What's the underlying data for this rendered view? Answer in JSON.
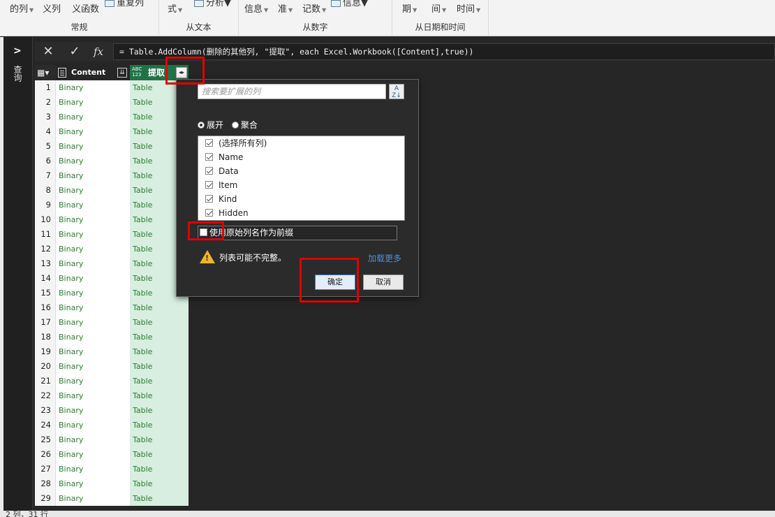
{
  "ribbon": {
    "groups": [
      {
        "label": "常规"
      },
      {
        "label": "从文本"
      },
      {
        "label": "从数字"
      },
      {
        "label": "从日期和时间"
      }
    ],
    "items": {
      "col_a": "的列",
      "col_b": "义列",
      "col_c": "义函数",
      "col_d": "重复列",
      "fmt": "式",
      "analyze": "分析",
      "info": "信息",
      "std": "准",
      "notation": "记数",
      "info2": "信息",
      "period": "期",
      "between": "间",
      "time": "时间"
    }
  },
  "rail": {
    "label": "查询"
  },
  "formula_bar": {
    "text": "= Table.AddColumn(删除的其他列, \"提取\", each Excel.Workbook([Content],true))"
  },
  "table": {
    "col1_header": "Content",
    "col2_header": "提取",
    "type_badge_top": "ABC",
    "type_badge_bottom": "123",
    "rows": [
      {
        "n": "1",
        "c1": "Binary",
        "c2": "Table"
      },
      {
        "n": "2",
        "c1": "Binary",
        "c2": "Table"
      },
      {
        "n": "3",
        "c1": "Binary",
        "c2": "Table"
      },
      {
        "n": "4",
        "c1": "Binary",
        "c2": "Table"
      },
      {
        "n": "5",
        "c1": "Binary",
        "c2": "Table"
      },
      {
        "n": "6",
        "c1": "Binary",
        "c2": "Table"
      },
      {
        "n": "7",
        "c1": "Binary",
        "c2": "Table"
      },
      {
        "n": "8",
        "c1": "Binary",
        "c2": "Table"
      },
      {
        "n": "9",
        "c1": "Binary",
        "c2": "Table"
      },
      {
        "n": "10",
        "c1": "Binary",
        "c2": "Table"
      },
      {
        "n": "11",
        "c1": "Binary",
        "c2": "Table"
      },
      {
        "n": "12",
        "c1": "Binary",
        "c2": "Table"
      },
      {
        "n": "13",
        "c1": "Binary",
        "c2": "Table"
      },
      {
        "n": "14",
        "c1": "Binary",
        "c2": "Table"
      },
      {
        "n": "15",
        "c1": "Binary",
        "c2": "Table"
      },
      {
        "n": "16",
        "c1": "Binary",
        "c2": "Table"
      },
      {
        "n": "17",
        "c1": "Binary",
        "c2": "Table"
      },
      {
        "n": "18",
        "c1": "Binary",
        "c2": "Table"
      },
      {
        "n": "19",
        "c1": "Binary",
        "c2": "Table"
      },
      {
        "n": "20",
        "c1": "Binary",
        "c2": "Table"
      },
      {
        "n": "21",
        "c1": "Binary",
        "c2": "Table"
      },
      {
        "n": "22",
        "c1": "Binary",
        "c2": "Table"
      },
      {
        "n": "23",
        "c1": "Binary",
        "c2": "Table"
      },
      {
        "n": "24",
        "c1": "Binary",
        "c2": "Table"
      },
      {
        "n": "25",
        "c1": "Binary",
        "c2": "Table"
      },
      {
        "n": "26",
        "c1": "Binary",
        "c2": "Table"
      },
      {
        "n": "27",
        "c1": "Binary",
        "c2": "Table"
      },
      {
        "n": "28",
        "c1": "Binary",
        "c2": "Table"
      },
      {
        "n": "29",
        "c1": "Binary",
        "c2": "Table"
      }
    ]
  },
  "popup": {
    "search_placeholder": "搜索要扩展的列",
    "radio_expand": "展开",
    "radio_aggregate": "聚合",
    "columns": [
      {
        "label": "(选择所有列)",
        "checked": true
      },
      {
        "label": "Name",
        "checked": true
      },
      {
        "label": "Data",
        "checked": true
      },
      {
        "label": "Item",
        "checked": true
      },
      {
        "label": "Kind",
        "checked": true
      },
      {
        "label": "Hidden",
        "checked": true
      }
    ],
    "prefix_label": "使用原始列名作为前缀",
    "warning": "列表可能不完整。",
    "load_more": "加载更多",
    "ok": "确定",
    "cancel": "取消"
  },
  "status": {
    "text": "2 列，31 行"
  },
  "colors": {
    "accent_green": "#217346",
    "highlight_red": "#e00000",
    "link_blue": "#4a90d9"
  }
}
